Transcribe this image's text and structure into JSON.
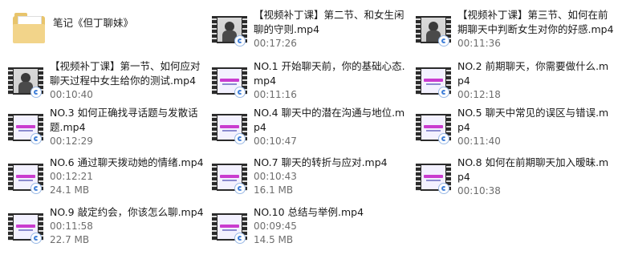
{
  "items": [
    {
      "name": "笔记《但丁聊妹》",
      "time": "",
      "size": "",
      "icon": "folder"
    },
    {
      "name": "【视频补丁课】第二节、和女生闲聊的守则.mp4",
      "time": "00:17:26",
      "size": "",
      "icon": "video-person"
    },
    {
      "name": "【视频补丁课】第三节、如何在前期聊天中判断女生对你的好感.mp4",
      "time": "00:11:36",
      "size": "",
      "icon": "video-person"
    },
    {
      "name": "【视频补丁课】第一节、如何应对聊天过程中女生给你的测试.mp4",
      "time": "00:10:40",
      "size": "",
      "icon": "video-person"
    },
    {
      "name": "NO.1 开始聊天前，你的基础心态.mp4",
      "time": "00:11:16",
      "size": "",
      "icon": "video-slide"
    },
    {
      "name": "NO.2 前期聊天，你需要做什么.mp4",
      "time": "00:12:18",
      "size": "",
      "icon": "video-slide"
    },
    {
      "name": "NO.3 如何正确找寻话题与发散话题.mp4",
      "time": "00:12:29",
      "size": "",
      "icon": "video-slide"
    },
    {
      "name": "NO.4 聊天中的潜在沟通与地位.mp4",
      "time": "00:10:47",
      "size": "",
      "icon": "video-slide"
    },
    {
      "name": "NO.5 聊天中常见的误区与错误.mp4",
      "time": "00:11:40",
      "size": "",
      "icon": "video-slide"
    },
    {
      "name": "NO.6 通过聊天拨动她的情绪.mp4",
      "time": "00:12:21",
      "size": "24.1 MB",
      "icon": "video-slide"
    },
    {
      "name": "NO.7 聊天的转折与应对.mp4",
      "time": "00:10:43",
      "size": "16.1 MB",
      "icon": "video-slide"
    },
    {
      "name": "NO.8 如何在前期聊天加入暧昧.mp4",
      "time": "00:10:38",
      "size": "",
      "icon": "video-slide"
    },
    {
      "name": "NO.9 敲定约会，你该怎么聊.mp4",
      "time": "00:11:58",
      "size": "22.7 MB",
      "icon": "video-slide"
    },
    {
      "name": "NO.10 总结与举例.mp4",
      "time": "00:09:45",
      "size": "14.5 MB",
      "icon": "video-slide"
    }
  ]
}
